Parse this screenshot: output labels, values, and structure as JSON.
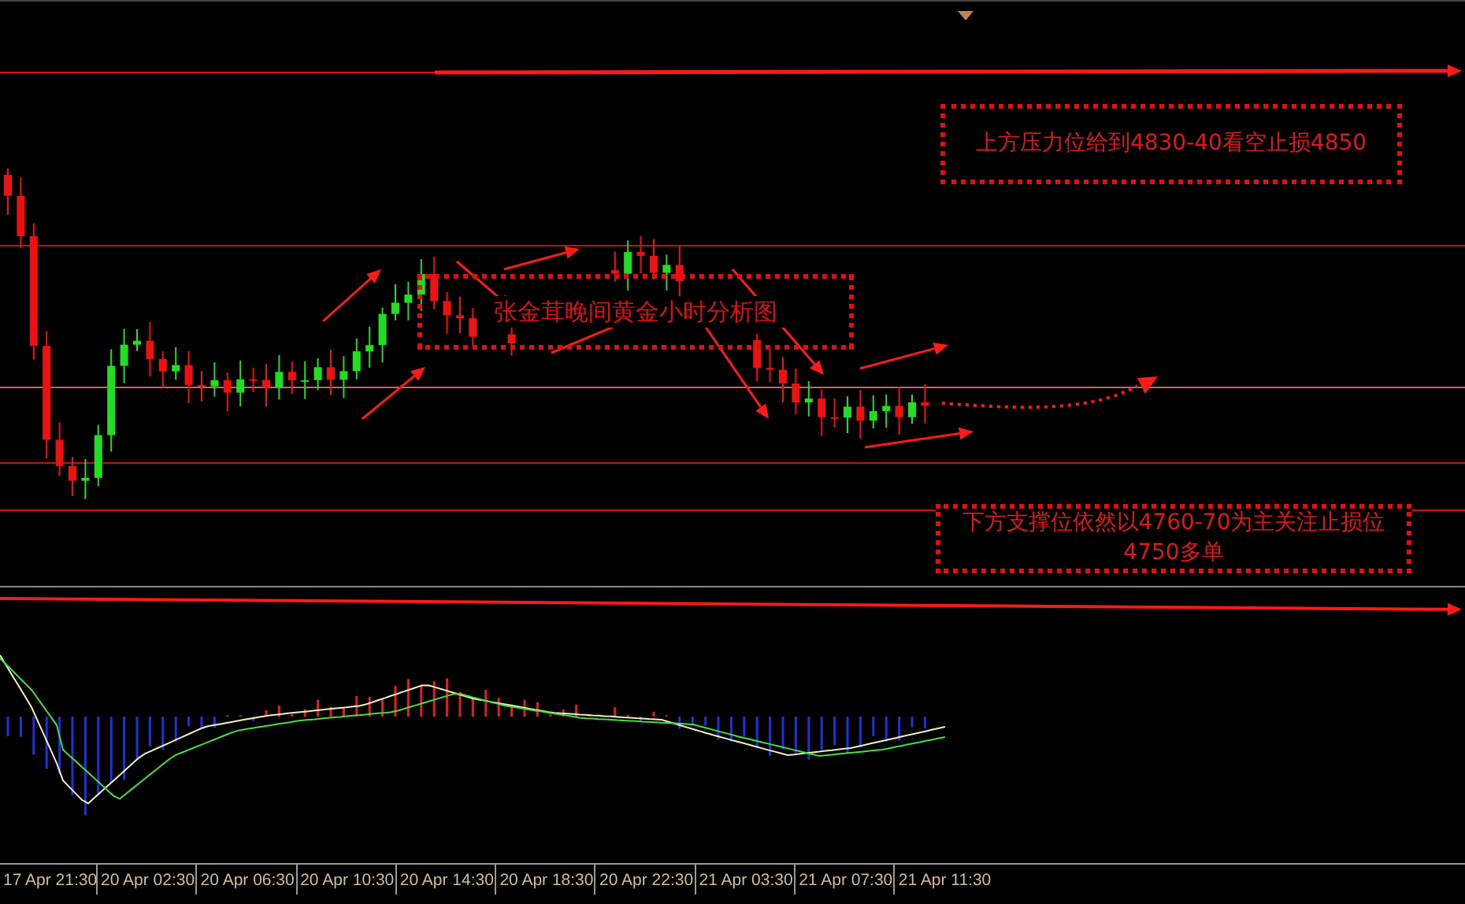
{
  "chart": {
    "title_annotation": "张金茸晚间黄金小时分析图",
    "annotations": [
      {
        "kind": "resistance",
        "text": "上方压力位给到4830-40看空止损4850"
      },
      {
        "kind": "support",
        "text": "下方支撑位依然以4760-70为主关注止损位4750多单"
      }
    ]
  },
  "x_axis": {
    "labels": [
      "17 Apr 21:30",
      "20 Apr 02:30",
      "20 Apr 06:30",
      "20 Apr 10:30",
      "20 Apr 14:30",
      "20 Apr 18:30",
      "20 Apr 22:30",
      "21 Apr 03:30",
      "21 Apr 07:30",
      "21 Apr 11:30"
    ]
  }
}
